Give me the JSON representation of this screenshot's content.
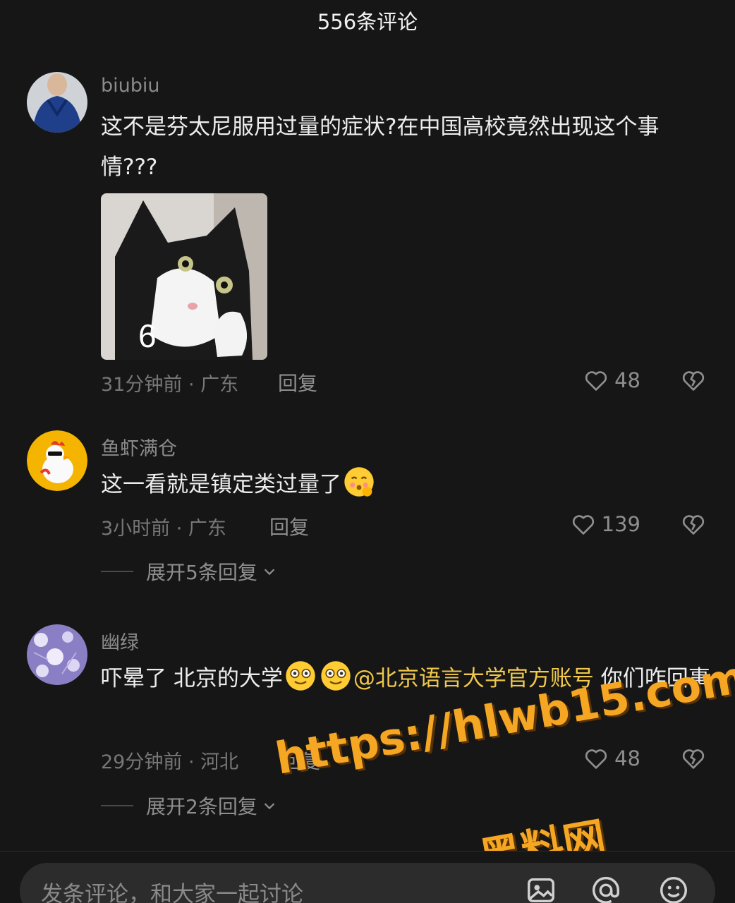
{
  "header": {
    "title": "556条评论"
  },
  "comments": [
    {
      "username": "biubiu",
      "text": "这不是芬太尼服用过量的症状?在中国高校竟然出现这个事情???",
      "sticker_label": "6",
      "time": "31分钟前",
      "location": "广东",
      "meta": "31分钟前 · 广东",
      "reply_label": "回复",
      "likes": "48"
    },
    {
      "username": "鱼虾满仓",
      "text": "这一看就是镇定类过量了",
      "time": "3小时前",
      "location": "广东",
      "meta": "3小时前 · 广东",
      "reply_label": "回复",
      "likes": "139",
      "expand_label": "展开5条回复"
    },
    {
      "username": "幽绿",
      "text_before": "吓晕了 北京的大学",
      "mention": "@北京语言大学官方账号",
      "text_after": " 你们咋回事",
      "time": "29分钟前",
      "location": "河北",
      "meta": "29分钟前 · 河北",
      "reply_label": "回复",
      "likes": "48",
      "expand_label": "展开2条回复"
    }
  ],
  "watermark": {
    "url": "https://hlwb15.com",
    "name": "黑料网"
  },
  "composer": {
    "placeholder": "发条评论，和大家一起讨论"
  },
  "icons": [
    "heart-icon",
    "broken-heart-icon",
    "chevron-down-icon",
    "image-icon",
    "at-icon",
    "emoji-icon"
  ],
  "colors": {
    "background": "#161616",
    "mention": "#f2c94c",
    "watermark": "#f5a623"
  }
}
